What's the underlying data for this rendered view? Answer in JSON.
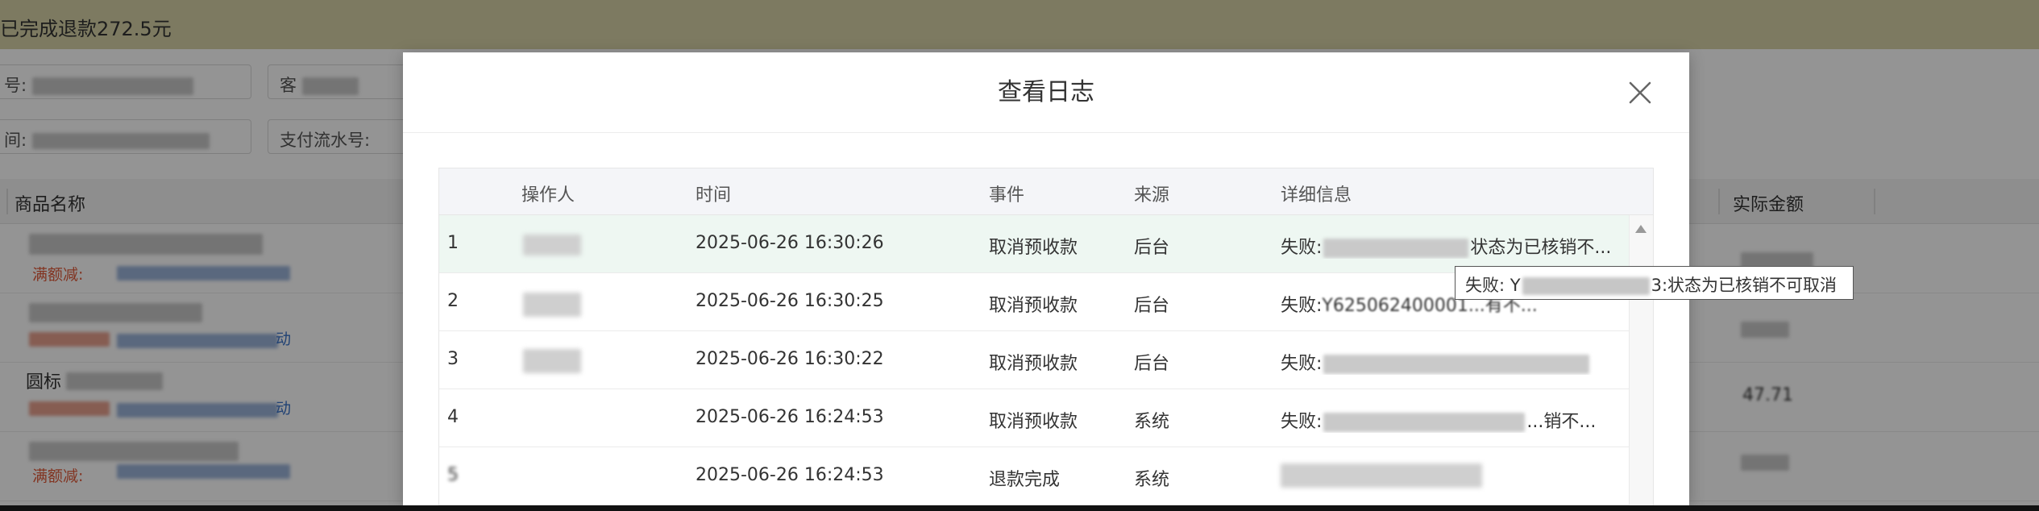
{
  "banner": {
    "text": "已完成退款272.5元"
  },
  "filters": {
    "order_no_label": "号:",
    "customer_label": "客",
    "time_label": "间:",
    "payment_flow_label": "支付流水号:"
  },
  "bg_table": {
    "columns": {
      "product_name": "商品名称",
      "actual_amount": "实际金额"
    },
    "rows": [
      {
        "promo": "满额减:",
        "link_tail": ""
      },
      {
        "promo": "",
        "link_tail": "动"
      },
      {
        "name_prefix": "圆标",
        "link_tail": "动",
        "amount": "47.71"
      },
      {
        "promo": "满额减:",
        "link_tail": ""
      }
    ]
  },
  "dialog": {
    "title": "查看日志",
    "columns": {
      "operator": "操作人",
      "time": "时间",
      "event": "事件",
      "source": "来源",
      "detail": "详细信息"
    },
    "rows": [
      {
        "index": "1",
        "time": "2025-06-26 16:30:26",
        "event": "取消预收款",
        "source": "后台",
        "detail_prefix": "失败:",
        "detail_suffix": "状态为已核销不..."
      },
      {
        "index": "2",
        "time": "2025-06-26 16:30:25",
        "event": "取消预收款",
        "source": "后台",
        "detail_prefix": "失败:",
        "detail_suffix": "Y625062400001...有不..."
      },
      {
        "index": "3",
        "time": "2025-06-26 16:30:22",
        "event": "取消预收款",
        "source": "后台",
        "detail_prefix": "失败:",
        "detail_suffix": ""
      },
      {
        "index": "4",
        "time": "2025-06-26 16:24:53",
        "event": "取消预收款",
        "source": "系统",
        "detail_prefix": "失败:",
        "detail_suffix": "...销不..."
      },
      {
        "index": "5",
        "time": "2025-06-26 16:24:53",
        "event": "退款完成",
        "source": "系统",
        "detail_prefix": "",
        "detail_suffix": ""
      }
    ],
    "tooltip": {
      "prefix": "失败: Y",
      "suffix": "3:状态为已核销不可取消"
    }
  },
  "icons": {
    "close": "close-icon",
    "scroll_up": "caret-up-icon"
  },
  "colors": {
    "banner_bg": "#d7d3a8",
    "active_row": "#eef7f2",
    "promo": "#e05a3a",
    "link": "#3a73c9"
  }
}
